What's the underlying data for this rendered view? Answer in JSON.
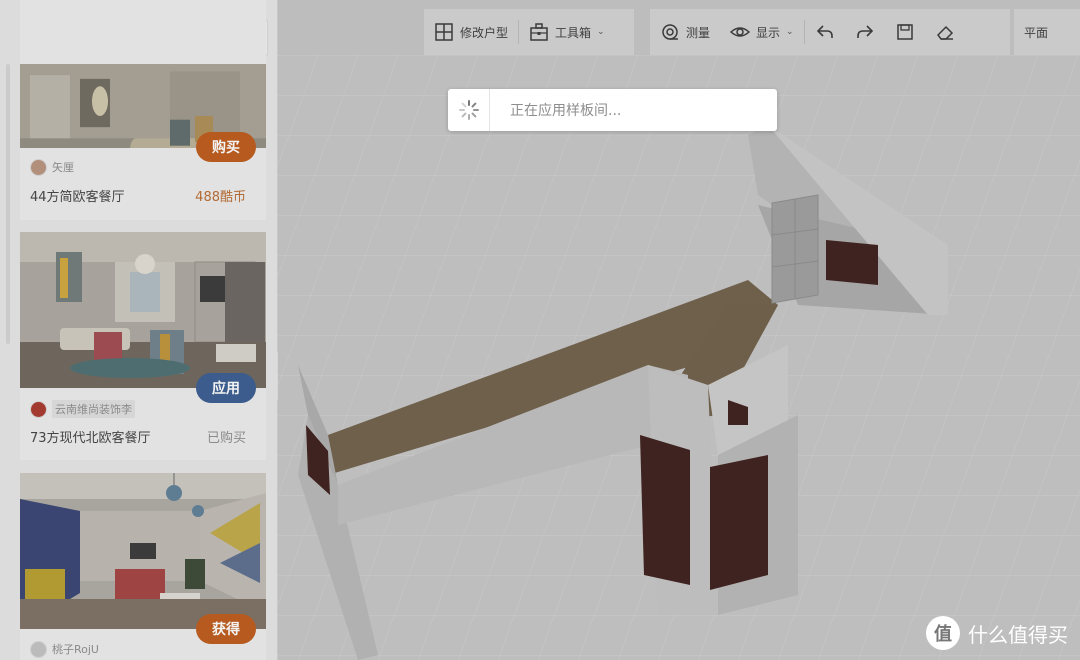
{
  "search": {
    "placeholder": ""
  },
  "templates": [
    {
      "designer": "矢厘",
      "title": "44方简欧客餐厅",
      "price": "488酷币",
      "action": "购买"
    },
    {
      "designer": "云南维尚装饰李",
      "title": "73方现代北欧客餐厅",
      "status": "已购买",
      "action": "应用"
    },
    {
      "designer": "桃子RojU",
      "action": "获得"
    }
  ],
  "toolbar": {
    "edit_floorplan": "修改户型",
    "toolbox": "工具箱",
    "measure": "测量",
    "display": "显示",
    "plan": "平面"
  },
  "loading": {
    "message": "正在应用样板间..."
  },
  "watermark": {
    "logo": "值",
    "text": "什么值得买"
  },
  "colors": {
    "buy_button": "#d86a22",
    "apply_button": "#4a74b5",
    "price": "#d8762d"
  },
  "icons": [
    "search-icon",
    "floorplan-icon",
    "toolbox-icon",
    "measure-icon",
    "eye-icon",
    "undo-icon",
    "redo-icon",
    "save-icon",
    "eraser-icon",
    "collapse-arrow-icon",
    "spinner-icon"
  ]
}
